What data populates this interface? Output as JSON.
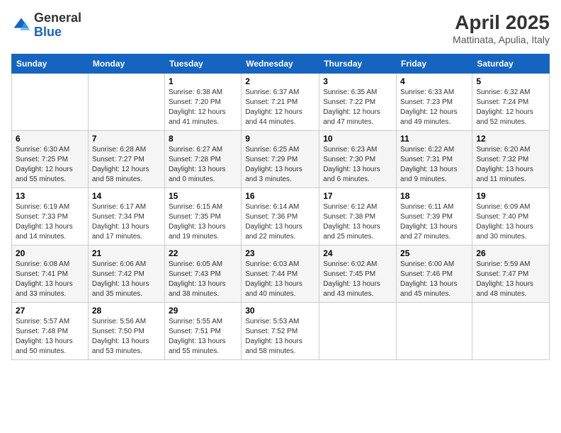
{
  "header": {
    "logo_general": "General",
    "logo_blue": "Blue",
    "month_title": "April 2025",
    "location": "Mattinata, Apulia, Italy"
  },
  "days_of_week": [
    "Sunday",
    "Monday",
    "Tuesday",
    "Wednesday",
    "Thursday",
    "Friday",
    "Saturday"
  ],
  "weeks": [
    [
      {
        "day": "",
        "sunrise": "",
        "sunset": "",
        "daylight": ""
      },
      {
        "day": "",
        "sunrise": "",
        "sunset": "",
        "daylight": ""
      },
      {
        "day": "1",
        "sunrise": "Sunrise: 6:38 AM",
        "sunset": "Sunset: 7:20 PM",
        "daylight": "Daylight: 12 hours and 41 minutes."
      },
      {
        "day": "2",
        "sunrise": "Sunrise: 6:37 AM",
        "sunset": "Sunset: 7:21 PM",
        "daylight": "Daylight: 12 hours and 44 minutes."
      },
      {
        "day": "3",
        "sunrise": "Sunrise: 6:35 AM",
        "sunset": "Sunset: 7:22 PM",
        "daylight": "Daylight: 12 hours and 47 minutes."
      },
      {
        "day": "4",
        "sunrise": "Sunrise: 6:33 AM",
        "sunset": "Sunset: 7:23 PM",
        "daylight": "Daylight: 12 hours and 49 minutes."
      },
      {
        "day": "5",
        "sunrise": "Sunrise: 6:32 AM",
        "sunset": "Sunset: 7:24 PM",
        "daylight": "Daylight: 12 hours and 52 minutes."
      }
    ],
    [
      {
        "day": "6",
        "sunrise": "Sunrise: 6:30 AM",
        "sunset": "Sunset: 7:25 PM",
        "daylight": "Daylight: 12 hours and 55 minutes."
      },
      {
        "day": "7",
        "sunrise": "Sunrise: 6:28 AM",
        "sunset": "Sunset: 7:27 PM",
        "daylight": "Daylight: 12 hours and 58 minutes."
      },
      {
        "day": "8",
        "sunrise": "Sunrise: 6:27 AM",
        "sunset": "Sunset: 7:28 PM",
        "daylight": "Daylight: 13 hours and 0 minutes."
      },
      {
        "day": "9",
        "sunrise": "Sunrise: 6:25 AM",
        "sunset": "Sunset: 7:29 PM",
        "daylight": "Daylight: 13 hours and 3 minutes."
      },
      {
        "day": "10",
        "sunrise": "Sunrise: 6:23 AM",
        "sunset": "Sunset: 7:30 PM",
        "daylight": "Daylight: 13 hours and 6 minutes."
      },
      {
        "day": "11",
        "sunrise": "Sunrise: 6:22 AM",
        "sunset": "Sunset: 7:31 PM",
        "daylight": "Daylight: 13 hours and 9 minutes."
      },
      {
        "day": "12",
        "sunrise": "Sunrise: 6:20 AM",
        "sunset": "Sunset: 7:32 PM",
        "daylight": "Daylight: 13 hours and 11 minutes."
      }
    ],
    [
      {
        "day": "13",
        "sunrise": "Sunrise: 6:19 AM",
        "sunset": "Sunset: 7:33 PM",
        "daylight": "Daylight: 13 hours and 14 minutes."
      },
      {
        "day": "14",
        "sunrise": "Sunrise: 6:17 AM",
        "sunset": "Sunset: 7:34 PM",
        "daylight": "Daylight: 13 hours and 17 minutes."
      },
      {
        "day": "15",
        "sunrise": "Sunrise: 6:15 AM",
        "sunset": "Sunset: 7:35 PM",
        "daylight": "Daylight: 13 hours and 19 minutes."
      },
      {
        "day": "16",
        "sunrise": "Sunrise: 6:14 AM",
        "sunset": "Sunset: 7:36 PM",
        "daylight": "Daylight: 13 hours and 22 minutes."
      },
      {
        "day": "17",
        "sunrise": "Sunrise: 6:12 AM",
        "sunset": "Sunset: 7:38 PM",
        "daylight": "Daylight: 13 hours and 25 minutes."
      },
      {
        "day": "18",
        "sunrise": "Sunrise: 6:11 AM",
        "sunset": "Sunset: 7:39 PM",
        "daylight": "Daylight: 13 hours and 27 minutes."
      },
      {
        "day": "19",
        "sunrise": "Sunrise: 6:09 AM",
        "sunset": "Sunset: 7:40 PM",
        "daylight": "Daylight: 13 hours and 30 minutes."
      }
    ],
    [
      {
        "day": "20",
        "sunrise": "Sunrise: 6:08 AM",
        "sunset": "Sunset: 7:41 PM",
        "daylight": "Daylight: 13 hours and 33 minutes."
      },
      {
        "day": "21",
        "sunrise": "Sunrise: 6:06 AM",
        "sunset": "Sunset: 7:42 PM",
        "daylight": "Daylight: 13 hours and 35 minutes."
      },
      {
        "day": "22",
        "sunrise": "Sunrise: 6:05 AM",
        "sunset": "Sunset: 7:43 PM",
        "daylight": "Daylight: 13 hours and 38 minutes."
      },
      {
        "day": "23",
        "sunrise": "Sunrise: 6:03 AM",
        "sunset": "Sunset: 7:44 PM",
        "daylight": "Daylight: 13 hours and 40 minutes."
      },
      {
        "day": "24",
        "sunrise": "Sunrise: 6:02 AM",
        "sunset": "Sunset: 7:45 PM",
        "daylight": "Daylight: 13 hours and 43 minutes."
      },
      {
        "day": "25",
        "sunrise": "Sunrise: 6:00 AM",
        "sunset": "Sunset: 7:46 PM",
        "daylight": "Daylight: 13 hours and 45 minutes."
      },
      {
        "day": "26",
        "sunrise": "Sunrise: 5:59 AM",
        "sunset": "Sunset: 7:47 PM",
        "daylight": "Daylight: 13 hours and 48 minutes."
      }
    ],
    [
      {
        "day": "27",
        "sunrise": "Sunrise: 5:57 AM",
        "sunset": "Sunset: 7:48 PM",
        "daylight": "Daylight: 13 hours and 50 minutes."
      },
      {
        "day": "28",
        "sunrise": "Sunrise: 5:56 AM",
        "sunset": "Sunset: 7:50 PM",
        "daylight": "Daylight: 13 hours and 53 minutes."
      },
      {
        "day": "29",
        "sunrise": "Sunrise: 5:55 AM",
        "sunset": "Sunset: 7:51 PM",
        "daylight": "Daylight: 13 hours and 55 minutes."
      },
      {
        "day": "30",
        "sunrise": "Sunrise: 5:53 AM",
        "sunset": "Sunset: 7:52 PM",
        "daylight": "Daylight: 13 hours and 58 minutes."
      },
      {
        "day": "",
        "sunrise": "",
        "sunset": "",
        "daylight": ""
      },
      {
        "day": "",
        "sunrise": "",
        "sunset": "",
        "daylight": ""
      },
      {
        "day": "",
        "sunrise": "",
        "sunset": "",
        "daylight": ""
      }
    ]
  ]
}
